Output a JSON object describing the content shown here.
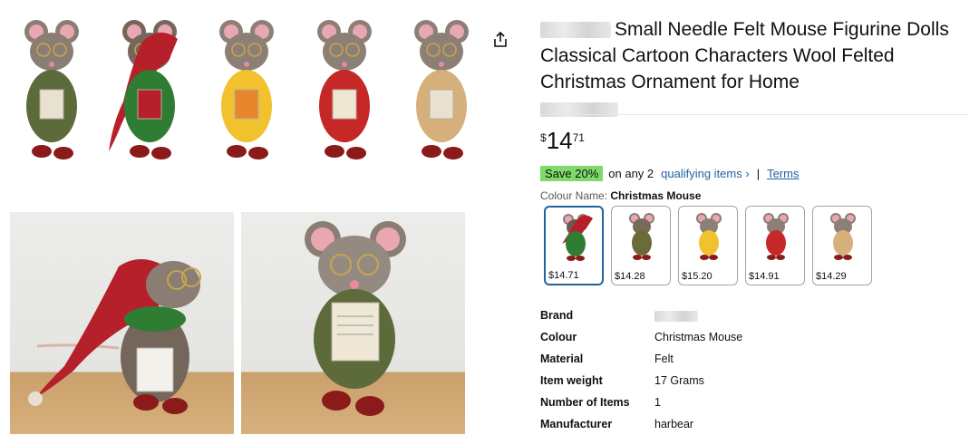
{
  "product": {
    "title": "Small Needle Felt Mouse Figurine Dolls Classical Cartoon Characters Wool Felted Christmas Ornament for Home",
    "price": {
      "symbol": "$",
      "whole": "14",
      "fraction": "71"
    },
    "promotion": {
      "badge": "Save 20%",
      "text": "on any 2",
      "link": "qualifying items ›",
      "separator": "|",
      "terms": "Terms"
    },
    "variant": {
      "label": "Colour Name:",
      "selected": "Christmas Mouse",
      "options": [
        {
          "price": "$14.71",
          "hat": "#b5202a",
          "scarf": "#2e7d32",
          "body": "#6b5a4e",
          "selected": true
        },
        {
          "price": "$14.28",
          "hat": "",
          "scarf": "#6d6a3a",
          "body": "#7a6a5c",
          "selected": false
        },
        {
          "price": "$15.20",
          "hat": "",
          "scarf": "#f2c12e",
          "body": "#8c7f76",
          "selected": false
        },
        {
          "price": "$14.91",
          "hat": "",
          "scarf": "#c62828",
          "body": "#8c7f76",
          "selected": false
        },
        {
          "price": "$14.29",
          "hat": "",
          "scarf": "#d6b07a",
          "body": "#8c7f76",
          "selected": false
        }
      ]
    },
    "specs": [
      {
        "key": "Brand",
        "value": ""
      },
      {
        "key": "Colour",
        "value": "Christmas Mouse"
      },
      {
        "key": "Material",
        "value": "Felt"
      },
      {
        "key": "Item weight",
        "value": "17 Grams"
      },
      {
        "key": "Number of Items",
        "value": "1"
      },
      {
        "key": "Manufacturer",
        "value": "harbear"
      }
    ]
  },
  "gallery": {
    "hero_figures": [
      {
        "name": "mouse-book",
        "body": "#8a7d74",
        "outfit": "#5d6b3b",
        "accent": "#e9e1cf",
        "hat": ""
      },
      {
        "name": "mouse-santa-hat",
        "body": "#75665c",
        "outfit": "#2e7d32",
        "accent": "#b5202a",
        "hat": "#b5202a"
      },
      {
        "name": "mouse-yellow-scarf",
        "body": "#8c7f76",
        "outfit": "#f2c12e",
        "accent": "#e8862e",
        "hat": ""
      },
      {
        "name": "mouse-red-dress",
        "body": "#8c7f76",
        "outfit": "#c62828",
        "accent": "#efe7d4",
        "hat": ""
      },
      {
        "name": "mouse-overalls",
        "body": "#8c7f76",
        "outfit": "#d6b07a",
        "accent": "#e9e1cf",
        "hat": ""
      }
    ]
  },
  "colors": {
    "link": "#2162a1",
    "badge": "#7fda69",
    "selected_border": "#2162a1"
  },
  "icons": {
    "share": "share-icon"
  }
}
